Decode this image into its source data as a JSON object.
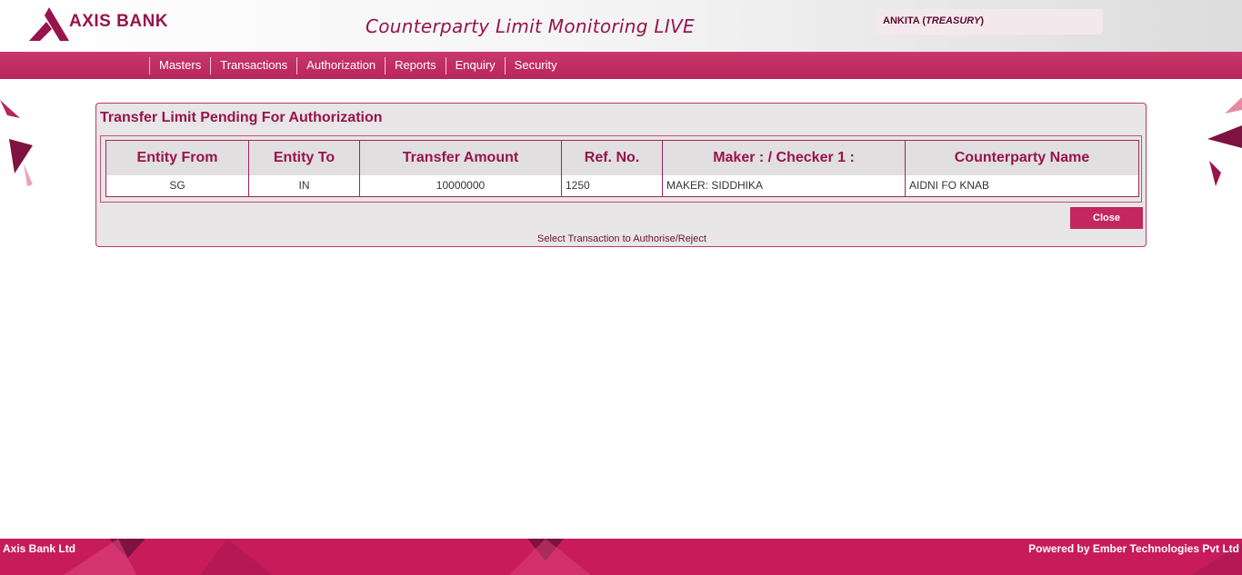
{
  "header": {
    "logo_text": "AXIS BANK",
    "app_title": "Counterparty Limit Monitoring LIVE",
    "user_name": "ANKITA (",
    "user_role": "TREASURY",
    "user_close": ")"
  },
  "nav": {
    "items": [
      "Masters",
      "Transactions",
      "Authorization",
      "Reports",
      "Enquiry",
      "Security"
    ]
  },
  "panel": {
    "title": "Transfer Limit Pending For Authorization",
    "columns": [
      "Entity From",
      "Entity To",
      "Transfer Amount",
      "Ref. No.",
      "Maker : / Checker 1 :",
      "Counterparty Name"
    ],
    "rows": [
      {
        "entity_from": "SG",
        "entity_to": "IN",
        "amount": "10000000",
        "ref_no": "1250",
        "maker": "MAKER: SIDDHIKA",
        "counterparty": "AIDNI FO KNAB"
      }
    ],
    "close_label": "Close",
    "hint": "Select Transaction to Authorise/Reject"
  },
  "footer": {
    "left": "Axis Bank Ltd",
    "right": "Powered by Ember Technologies Pvt Ltd"
  },
  "colors": {
    "brand": "#97144d",
    "nav": "#c8386a",
    "footer": "#c81c5a"
  },
  "icons": {
    "logo": "axis-bank-logo-icon"
  }
}
